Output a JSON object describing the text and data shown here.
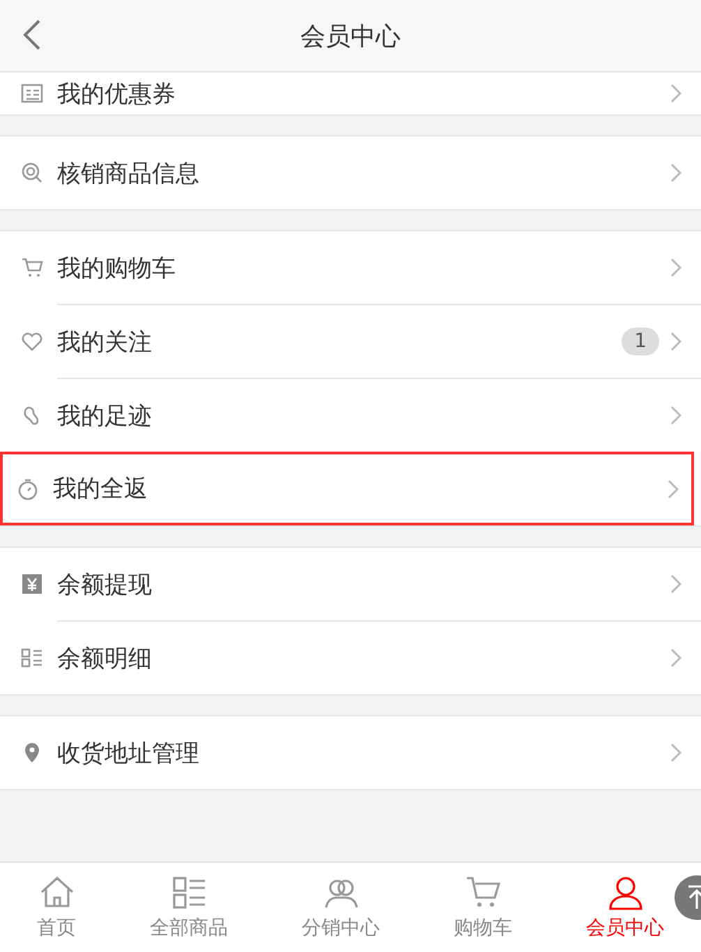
{
  "header": {
    "title": "会员中心"
  },
  "groups": [
    {
      "items": [
        {
          "label": "我的优惠券",
          "highlighted": false
        }
      ]
    },
    {
      "items": [
        {
          "label": "核销商品信息",
          "highlighted": false
        }
      ]
    },
    {
      "items": [
        {
          "label": "我的购物车",
          "highlighted": false
        },
        {
          "label": "我的关注",
          "badge": "1",
          "highlighted": false
        },
        {
          "label": "我的足迹",
          "highlighted": false
        },
        {
          "label": "我的全返",
          "highlighted": true
        }
      ]
    },
    {
      "items": [
        {
          "label": "余额提现",
          "highlighted": false
        },
        {
          "label": "余额明细",
          "highlighted": false
        }
      ]
    },
    {
      "items": [
        {
          "label": "收货地址管理",
          "highlighted": false
        }
      ]
    }
  ],
  "tab_bar": [
    {
      "label": "首页",
      "selected": false
    },
    {
      "label": "全部商品",
      "selected": false
    },
    {
      "label": "分销中心",
      "selected": false
    },
    {
      "label": "购物车",
      "selected": false
    },
    {
      "label": "会员中心",
      "selected": true
    }
  ]
}
